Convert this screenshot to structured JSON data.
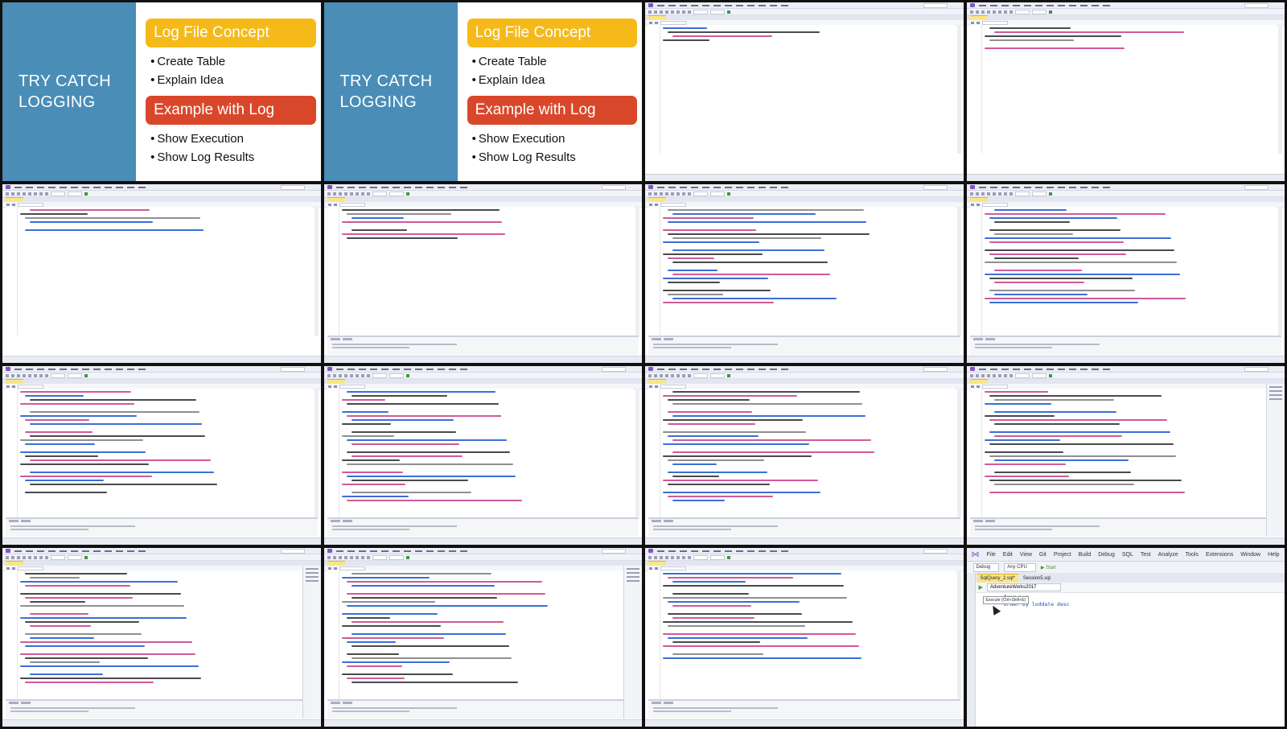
{
  "slide": {
    "title": "TRY CATCH LOGGING",
    "pill1": "Log File Concept",
    "pill2": "Example with Log",
    "bullets1": [
      "Create Table",
      "Explain Idea"
    ],
    "bullets2": [
      "Show Execution",
      "Show Log Results"
    ],
    "colors": {
      "left_panel": "#4a8db7",
      "pill_yellow": "#f5b919",
      "pill_red": "#d9472b"
    }
  },
  "vs_tile_count": 13,
  "zoom": {
    "logo": "⋈",
    "menu": [
      "File",
      "Edit",
      "View",
      "Git",
      "Project",
      "Build",
      "Debug",
      "SQL",
      "Test",
      "Analyze",
      "Tools",
      "Extensions",
      "Window",
      "Help"
    ],
    "search_placeholder": "Search (Ctrl+Q)",
    "config": "Debug",
    "platform": "Any CPU",
    "start": "▶ Start",
    "tabs": [
      "SqlQuery_2.sql*",
      "Session5.sql"
    ],
    "execute_icon": "▶",
    "database": "AdventureWorks2017",
    "tooltip": "Execute (Ctrl+Shift+E)",
    "code": [
      "from Log",
      "order by loddate desc"
    ]
  }
}
